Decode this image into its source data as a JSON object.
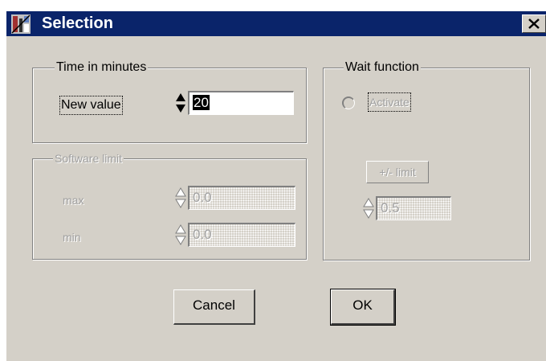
{
  "window": {
    "title": "Selection",
    "icon": "app-icon",
    "close_icon": "close-icon"
  },
  "time_group": {
    "legend": "Time in minutes",
    "new_value_label": "New value",
    "new_value": "20"
  },
  "software_limit": {
    "legend": "Software limit",
    "max_label": "max",
    "max_value": "0.0",
    "min_label": "min",
    "min_value": "0.0"
  },
  "wait_function": {
    "legend": "Wait function",
    "activate_label": "Activate",
    "limit_button": "+/- limit",
    "limit_value": "0.5"
  },
  "buttons": {
    "cancel": "Cancel",
    "ok": "OK"
  },
  "colors": {
    "title_bar": "#0a246a",
    "face": "#d4d0c8",
    "disabled_text": "#a0a0a0"
  }
}
